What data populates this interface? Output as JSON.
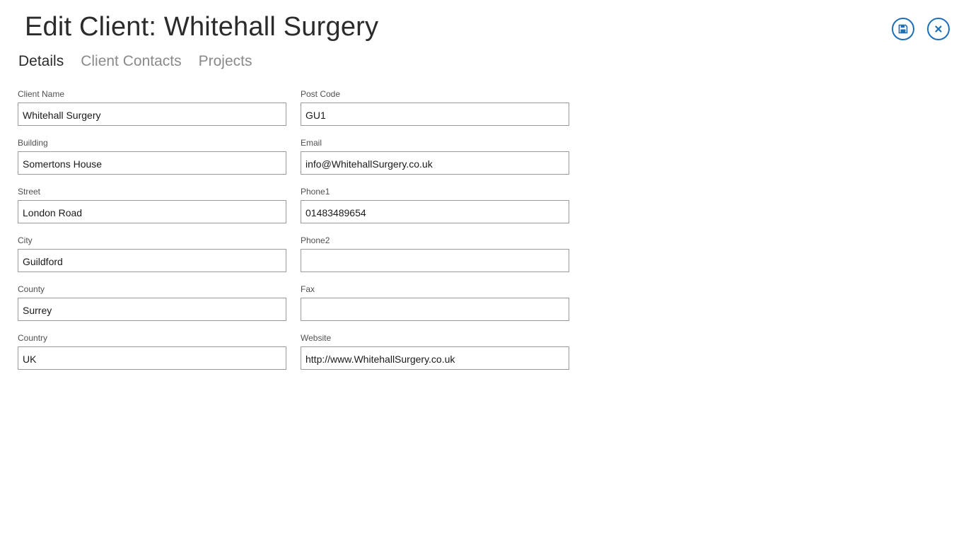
{
  "header": {
    "title": "Edit Client: Whitehall Surgery",
    "save_icon": "floppy-disk-save-icon",
    "close_icon": "close-x-icon",
    "accent_color": "#1e6fb8"
  },
  "tabs": [
    {
      "label": "Details",
      "active": true
    },
    {
      "label": "Client Contacts",
      "active": false
    },
    {
      "label": "Projects",
      "active": false
    }
  ],
  "form": {
    "left": [
      {
        "label": "Client Name",
        "value": "Whitehall Surgery"
      },
      {
        "label": "Building",
        "value": "Somertons House"
      },
      {
        "label": "Street",
        "value": "London Road"
      },
      {
        "label": "City",
        "value": "Guildford"
      },
      {
        "label": "County",
        "value": "Surrey"
      },
      {
        "label": "Country",
        "value": "UK"
      }
    ],
    "right": [
      {
        "label": "Post Code",
        "value": "GU1"
      },
      {
        "label": "Email",
        "value": "info@WhitehallSurgery.co.uk"
      },
      {
        "label": "Phone1",
        "value": "01483489654"
      },
      {
        "label": "Phone2",
        "value": ""
      },
      {
        "label": "Fax",
        "value": ""
      },
      {
        "label": "Website",
        "value": "http://www.WhitehallSurgery.co.uk"
      }
    ]
  }
}
